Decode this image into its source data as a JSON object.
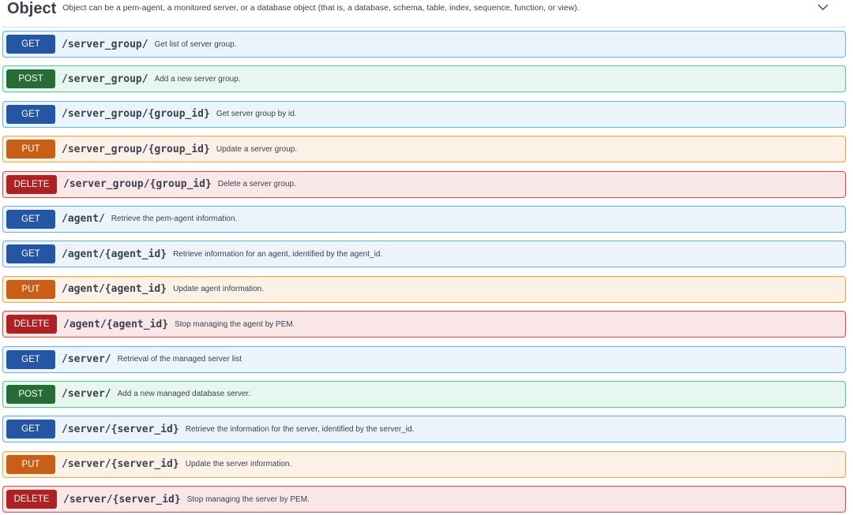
{
  "section": {
    "title": "Object",
    "description": "Object can be a pem-agent, a monitored server, or a database object (that is, a database, schema, table, index, sequence, function, or view).",
    "toggle_icon": "chevron-down-icon"
  },
  "operations": [
    {
      "method": "GET",
      "path": "/server_group/",
      "summary": "Get list of server group."
    },
    {
      "method": "POST",
      "path": "/server_group/",
      "summary": "Add a new server group."
    },
    {
      "method": "GET",
      "path": "/server_group/{group_id}",
      "summary": "Get server group by id."
    },
    {
      "method": "PUT",
      "path": "/server_group/{group_id}",
      "summary": "Update a server group."
    },
    {
      "method": "DELETE",
      "path": "/server_group/{group_id}",
      "summary": "Delete a server group."
    },
    {
      "method": "GET",
      "path": "/agent/",
      "summary": "Retrieve the pem-agent information."
    },
    {
      "method": "GET",
      "path": "/agent/{agent_id}",
      "summary": "Retrieve information for an agent, identified by the agent_id."
    },
    {
      "method": "PUT",
      "path": "/agent/{agent_id}",
      "summary": "Update agent information."
    },
    {
      "method": "DELETE",
      "path": "/agent/{agent_id}",
      "summary": "Stop managing the agent by PEM."
    },
    {
      "method": "GET",
      "path": "/server/",
      "summary": "Retrieval of the managed server list"
    },
    {
      "method": "POST",
      "path": "/server/",
      "summary": "Add a new managed database server."
    },
    {
      "method": "GET",
      "path": "/server/{server_id}",
      "summary": "Retrieve the information for the server, identified by the server_id."
    },
    {
      "method": "PUT",
      "path": "/server/{server_id}",
      "summary": "Update the server information."
    },
    {
      "method": "DELETE",
      "path": "/server/{server_id}",
      "summary": "Stop managing the server by PEM."
    }
  ],
  "colors": {
    "get": "#2456a4",
    "post": "#276c35",
    "put": "#c95f16",
    "delete": "#ac2121"
  }
}
